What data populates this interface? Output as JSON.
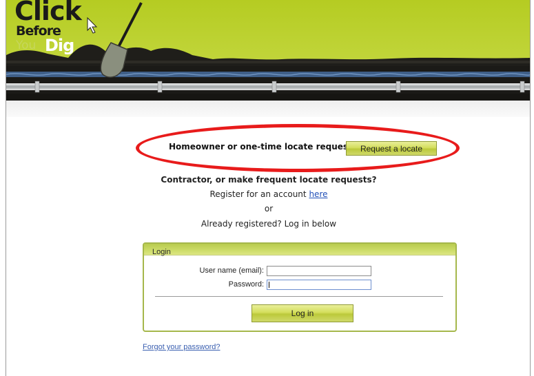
{
  "logo": {
    "click": "Click",
    "before": "Before",
    "you": "You",
    "dig": "Dig"
  },
  "request": {
    "label": "Homeowner or one-time locate request?",
    "button": "Request a locate"
  },
  "contractor": {
    "heading": "Contractor, or make frequent locate requests?",
    "register_text": "Register for an account",
    "register_link": "here",
    "or": "or",
    "already": "Already registered? Log in below"
  },
  "login": {
    "title": "Login",
    "username_label": "User name (email):",
    "username_value": "",
    "password_label": "Password:",
    "password_value": "",
    "button": "Log in"
  },
  "forgot": "Forgot your password?",
  "colors": {
    "banner_green": "#b9cf2b",
    "accent_red": "#e81b1b",
    "panel_border": "#a5b74b",
    "link": "#2150b8"
  }
}
